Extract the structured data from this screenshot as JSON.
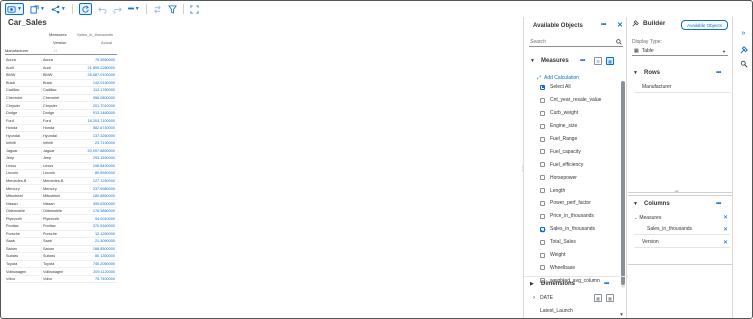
{
  "toolbar": {
    "icons": [
      "display-icon",
      "insert-icon",
      "share-icon",
      "refresh-icon",
      "undo-icon",
      "redo-icon",
      "more-icon",
      "swap-axis-icon",
      "filter-icon",
      "fullscreen-icon"
    ]
  },
  "table": {
    "title": "Car_Sales",
    "header_measures": "Measures",
    "header_measure_name": "Sales_in_thousands",
    "header_version": "Version",
    "header_version_value": "Actual",
    "header_manufacturer": "Manufacturer",
    "sort_glyph": "↓↑",
    "rows": [
      [
        "Acura",
        "Acura",
        "79.5550000"
      ],
      [
        "Audi",
        "Audi",
        "21,899.2280000"
      ],
      [
        "BMW",
        "BMW",
        "28,687.0100000"
      ],
      [
        "Buick",
        "Buick",
        "142.0130000"
      ],
      [
        "Cadillac",
        "Cadillac",
        "112.1780000"
      ],
      [
        "Chevrolet",
        "Chevrolet",
        "956.0800000"
      ],
      [
        "Chrysler",
        "Chrysler",
        "201.7010000"
      ],
      [
        "Dodge",
        "Dodge",
        "913.1480000"
      ],
      [
        "Ford",
        "Ford",
        "18,203.7100000"
      ],
      [
        "Honda",
        "Honda",
        "582.6740000"
      ],
      [
        "Hyundai",
        "Hyundai",
        "137.3260000"
      ],
      [
        "Infiniti",
        "Infiniti",
        "23.7130000"
      ],
      [
        "Jaguar",
        "Jaguar",
        "20,097.8890000"
      ],
      [
        "Jeep",
        "Jeep",
        "293.1530000"
      ],
      [
        "Lexus",
        "Lexus",
        "106.8430000"
      ],
      [
        "Lincoln",
        "Lincoln",
        "80.6940000"
      ],
      [
        "Mercedes-B",
        "Mercedes-B",
        "127.1250000"
      ],
      [
        "Mercury",
        "Mercury",
        "237.6980000"
      ],
      [
        "Mitsubishi",
        "Mitsubishi",
        "180.8850000"
      ],
      [
        "Nissan",
        "Nissan",
        "399.6300000"
      ],
      [
        "Oldsmobile",
        "Oldsmobile",
        "178.9880000"
      ],
      [
        "Plymouth",
        "Plymouth",
        "94.0010000"
      ],
      [
        "Pontiac",
        "Pontiac",
        "370.5340000"
      ],
      [
        "Porsche",
        "Porsche",
        "12.1280000"
      ],
      [
        "Saab",
        "Saab",
        "21.3090000"
      ],
      [
        "Saturn",
        "Saturn",
        "168.8500000"
      ],
      [
        "Subaru",
        "Subaru",
        "80.1350000"
      ],
      [
        "Toyota",
        "Toyota",
        "740.2050000"
      ],
      [
        "Volkswagen",
        "Volkswagen",
        "209.1120000"
      ],
      [
        "Volvo",
        "Volvo",
        "75.7400000"
      ]
    ]
  },
  "available": {
    "title": "Available Objects",
    "search_placeholder": "Search",
    "measures_label": "Measures",
    "add_calc": "Add Calculation",
    "select_all": "Select All",
    "measures": [
      {
        "name": "Cnt_year_resale_value",
        "checked": false
      },
      {
        "name": "Curb_weight",
        "checked": false
      },
      {
        "name": "Engine_size",
        "checked": false
      },
      {
        "name": "Fuel_Range",
        "checked": false
      },
      {
        "name": "Fuel_capacity",
        "checked": false
      },
      {
        "name": "Fuel_efficiency",
        "checked": false
      },
      {
        "name": "Horsepower",
        "checked": false
      },
      {
        "name": "Length",
        "checked": false
      },
      {
        "name": "Power_perf_factor",
        "checked": false
      },
      {
        "name": "Price_in_thousands",
        "checked": false
      },
      {
        "name": "Sales_in_thousands",
        "checked": true
      },
      {
        "name": "Total_Sales",
        "checked": false
      },
      {
        "name": "Weight",
        "checked": false
      },
      {
        "name": "Wheelbase",
        "checked": false
      },
      {
        "name": "weighted_avg_column",
        "checked": false
      }
    ],
    "dimensions_label": "Dimensions",
    "dimensions": [
      "DATE",
      "Latest_Launch"
    ]
  },
  "builder": {
    "title": "Builder",
    "available_objects_button": "Available Objects",
    "display_type_label": "Display Type:",
    "display_type_value": "Table",
    "rows_label": "Rows",
    "rows_items": [
      "Manufacturer"
    ],
    "columns_label": "Columns",
    "columns_measures": "Measures",
    "columns_measure_item": "Sales_in_thousands",
    "columns_version": "Version"
  },
  "colors": {
    "accent": "#0a6ed1",
    "text": "#32363a",
    "border": "#d9d9d9"
  }
}
